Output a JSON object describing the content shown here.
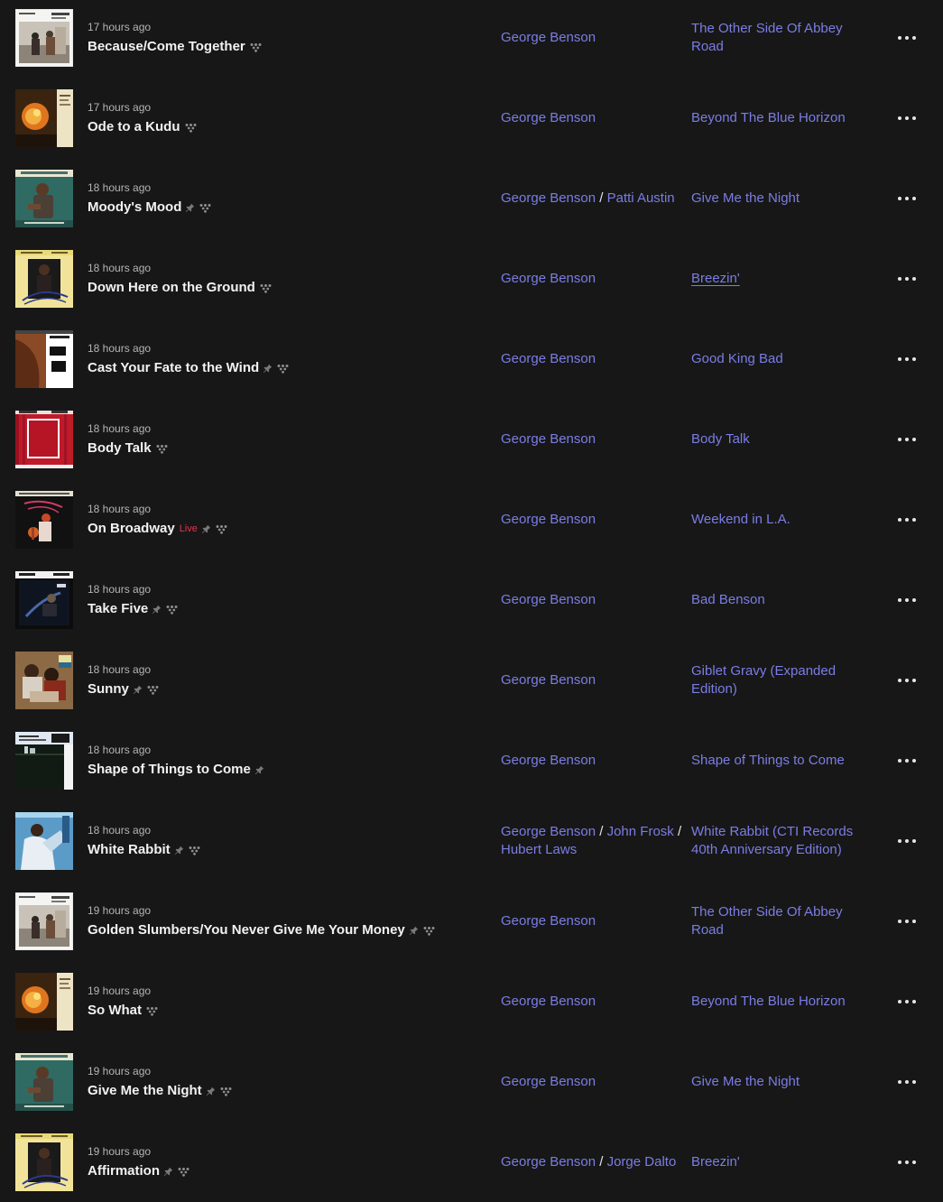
{
  "icons": {
    "pin": "pin-icon",
    "spotify": "spotify-icon",
    "more": "more-options-icon"
  },
  "colors": {
    "background": "#171717",
    "link": "#7b7de5",
    "title": "#f2f2f2",
    "time": "#b5b5b5",
    "live_badge": "#e0344d"
  },
  "tracks": [
    {
      "time": "17 hours ago",
      "title": "Because/Come Together",
      "live": false,
      "pin": false,
      "artists": [
        "George Benson"
      ],
      "album": "The Other Side Of Abbey Road",
      "album_underlined": false,
      "cover": "abbey"
    },
    {
      "time": "17 hours ago",
      "title": "Ode to a Kudu",
      "live": false,
      "pin": false,
      "artists": [
        "George Benson"
      ],
      "album": "Beyond The Blue Horizon",
      "album_underlined": false,
      "cover": "horizon"
    },
    {
      "time": "18 hours ago",
      "title": "Moody's Mood",
      "live": false,
      "pin": true,
      "artists": [
        "George Benson",
        "Patti Austin"
      ],
      "album": "Give Me the Night",
      "album_underlined": false,
      "cover": "night"
    },
    {
      "time": "18 hours ago",
      "title": "Down Here on the Ground",
      "live": false,
      "pin": false,
      "artists": [
        "George Benson"
      ],
      "album": "Breezin'",
      "album_underlined": true,
      "cover": "breezin"
    },
    {
      "time": "18 hours ago",
      "title": "Cast Your Fate to the Wind",
      "live": false,
      "pin": true,
      "artists": [
        "George Benson"
      ],
      "album": "Good King Bad",
      "album_underlined": false,
      "cover": "goodking"
    },
    {
      "time": "18 hours ago",
      "title": "Body Talk",
      "live": false,
      "pin": false,
      "artists": [
        "George Benson"
      ],
      "album": "Body Talk",
      "album_underlined": false,
      "cover": "bodytalk"
    },
    {
      "time": "18 hours ago",
      "title": "On Broadway",
      "live": true,
      "live_label": "Live",
      "pin": true,
      "artists": [
        "George Benson"
      ],
      "album": "Weekend in L.A.",
      "album_underlined": false,
      "cover": "weekend"
    },
    {
      "time": "18 hours ago",
      "title": "Take Five",
      "live": false,
      "pin": true,
      "artists": [
        "George Benson"
      ],
      "album": "Bad Benson",
      "album_underlined": false,
      "cover": "badbenson"
    },
    {
      "time": "18 hours ago",
      "title": "Sunny",
      "live": false,
      "pin": true,
      "artists": [
        "George Benson"
      ],
      "album": "Giblet Gravy (Expanded Edition)",
      "album_underlined": false,
      "cover": "giblet"
    },
    {
      "time": "18 hours ago",
      "title": "Shape of Things to Come",
      "live": false,
      "pin": true,
      "spotify": false,
      "artists": [
        "George Benson"
      ],
      "album": "Shape of Things to Come",
      "album_underlined": false,
      "cover": "shape"
    },
    {
      "time": "18 hours ago",
      "title": "White Rabbit",
      "live": false,
      "pin": true,
      "artists": [
        "George Benson",
        "John Frosk",
        "Hubert Laws"
      ],
      "album": "White Rabbit (CTI Records 40th Anniversary Edition)",
      "album_underlined": false,
      "cover": "rabbit"
    },
    {
      "time": "19 hours ago",
      "title": "Golden Slumbers/You Never Give Me Your Money",
      "live": false,
      "pin": true,
      "artists": [
        "George Benson"
      ],
      "album": "The Other Side Of Abbey Road",
      "album_underlined": false,
      "cover": "abbey"
    },
    {
      "time": "19 hours ago",
      "title": "So What",
      "live": false,
      "pin": false,
      "artists": [
        "George Benson"
      ],
      "album": "Beyond The Blue Horizon",
      "album_underlined": false,
      "cover": "horizon"
    },
    {
      "time": "19 hours ago",
      "title": "Give Me the Night",
      "live": false,
      "pin": true,
      "artists": [
        "George Benson"
      ],
      "album": "Give Me the Night",
      "album_underlined": false,
      "cover": "night"
    },
    {
      "time": "19 hours ago",
      "title": "Affirmation",
      "live": false,
      "pin": true,
      "artists": [
        "George Benson",
        "Jorge Dalto"
      ],
      "album": "Breezin'",
      "album_underlined": false,
      "cover": "breezin"
    }
  ]
}
